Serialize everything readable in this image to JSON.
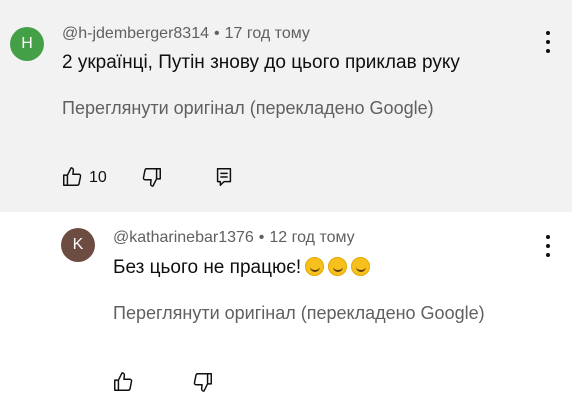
{
  "comments": [
    {
      "avatar_letter": "H",
      "author": "@h-jdemberger8314",
      "time": "17 год тому",
      "text": "2 українці, Путін знову до цього приклав руку",
      "translate_label": "Переглянути оригінал (перекладено Google)",
      "likes": "10"
    },
    {
      "avatar_letter": "K",
      "author": "@katharinebar1376",
      "time": "12 год тому",
      "text": "Без цього не працює!",
      "emoji": [
        "rolling-on-floor-laughing",
        "rolling-on-floor-laughing",
        "rolling-on-floor-laughing"
      ],
      "translate_label": "Переглянути оригінал (перекладено Google)"
    }
  ],
  "separator": "•",
  "icons": {
    "like": "thumbs-up-icon",
    "dislike": "thumbs-down-icon",
    "reply": "reply-comment-icon",
    "menu": "more-vert-icon"
  },
  "colors": {
    "avatar_h": "#43a047",
    "avatar_k": "#6d4c41",
    "secondary_text": "#606060",
    "highlight_bg": "#f2f2f2"
  }
}
